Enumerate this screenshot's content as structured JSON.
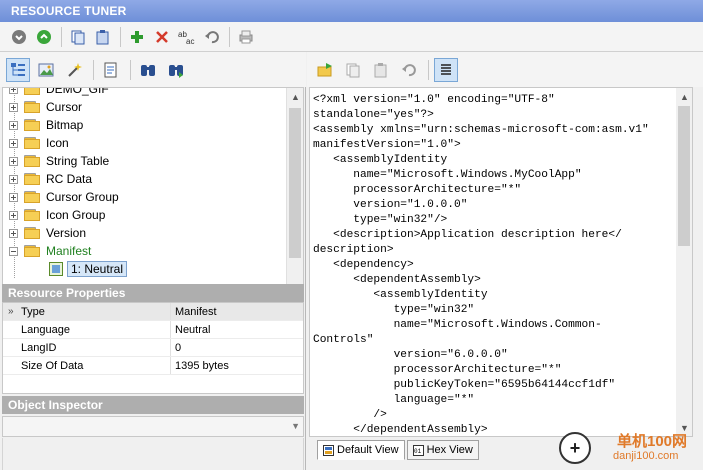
{
  "window": {
    "title": "RESOURCE TUNER"
  },
  "toolbar": {
    "buttons": [
      "down-arrow-icon",
      "up-arrow-icon",
      "copy-icon",
      "paste-icon",
      "add-icon",
      "delete-icon",
      "rename-icon",
      "undo-icon",
      "print-icon"
    ]
  },
  "left_toolbar": {
    "buttons": [
      "tree-view-icon",
      "image-view-icon",
      "wand-icon",
      "resource-icon",
      "find-icon",
      "find-next-icon"
    ]
  },
  "tree": {
    "items": [
      {
        "label": "DEMO_GIF"
      },
      {
        "label": "Cursor"
      },
      {
        "label": "Bitmap"
      },
      {
        "label": "Icon"
      },
      {
        "label": "String Table"
      },
      {
        "label": "RC Data"
      },
      {
        "label": "Cursor Group"
      },
      {
        "label": "Icon Group"
      },
      {
        "label": "Version"
      },
      {
        "label": "Manifest"
      }
    ],
    "child": {
      "label": "1: Neutral"
    }
  },
  "properties": {
    "header": "Resource Properties",
    "rows": [
      {
        "key": "Type",
        "value": "Manifest"
      },
      {
        "key": "Language",
        "value": "Neutral"
      },
      {
        "key": "LangID",
        "value": "0"
      },
      {
        "key": "Size Of Data",
        "value": "1395 bytes"
      }
    ]
  },
  "inspector": {
    "header": "Object Inspector"
  },
  "right_toolbar": {
    "buttons": [
      "open-folder-icon",
      "copy-icon",
      "paste-icon",
      "undo-icon",
      "text-view-icon"
    ]
  },
  "code": {
    "lines": [
      "<?xml version=\"1.0\" encoding=\"UTF-8\"",
      "standalone=\"yes\"?>",
      "<assembly xmlns=\"urn:schemas-microsoft-com:asm.v1\"",
      "manifestVersion=\"1.0\">",
      "   <assemblyIdentity",
      "      name=\"Microsoft.Windows.MyCoolApp\"",
      "      processorArchitecture=\"*\"",
      "      version=\"1.0.0.0\"",
      "      type=\"win32\"/>",
      "   <description>Application description here</",
      "description>",
      "   <dependency>",
      "      <dependentAssembly>",
      "         <assemblyIdentity",
      "            type=\"win32\"",
      "            name=\"Microsoft.Windows.Common-",
      "Controls\"",
      "            version=\"6.0.0.0\"",
      "            processorArchitecture=\"*\"",
      "            publicKeyToken=\"6595b64144ccf1df\"",
      "            language=\"*\"",
      "         />",
      "      </dependentAssembly>"
    ]
  },
  "tabs": [
    {
      "label": "Default View",
      "icon": "default-view-icon"
    },
    {
      "label": "Hex View",
      "icon": "hex-view-icon"
    }
  ],
  "watermark": {
    "text1": "单机100网",
    "text2": "danji100.com"
  }
}
